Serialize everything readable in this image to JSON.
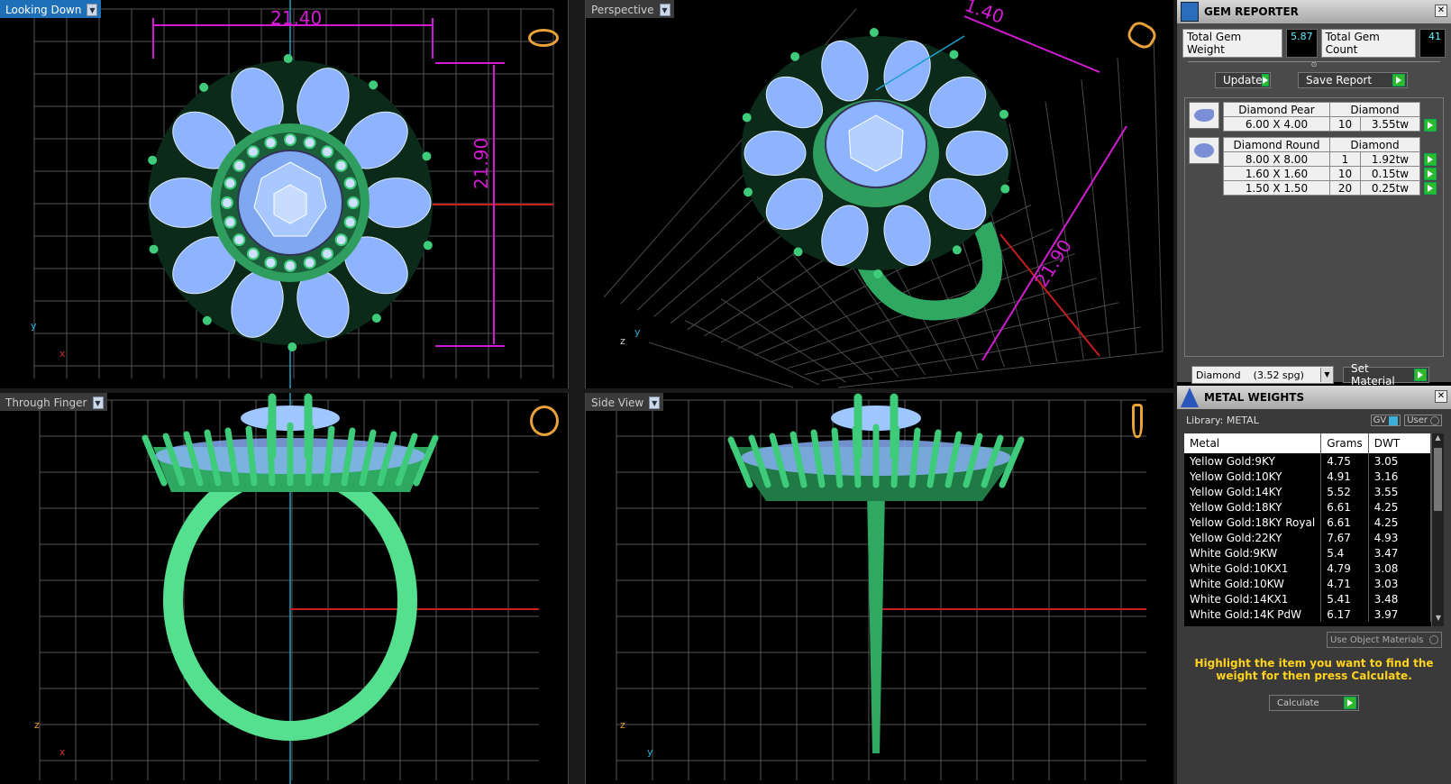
{
  "viewports": {
    "top_left": {
      "label": "Looking Down",
      "dim_width": "21.40",
      "dim_height": "21.90",
      "axis_y": "y",
      "axis_x": "x"
    },
    "top_right": {
      "label": "Perspective",
      "dim_width": "1.40",
      "dim_height": "21.90",
      "axis_z": "z",
      "axis_y": "y"
    },
    "bottom_left": {
      "label": "Through Finger",
      "axis_z": "z",
      "axis_x": "x"
    },
    "bottom_right": {
      "label": "Side View",
      "axis_z": "z",
      "axis_y": "y"
    }
  },
  "gem_reporter": {
    "title": "GEM REPORTER",
    "total_weight_label": "Total Gem Weight",
    "total_weight_value": "5.87",
    "total_count_label": "Total Gem Count",
    "total_count_value": "41",
    "update_label": "Update",
    "save_report_label": "Save Report",
    "groups": [
      {
        "shape": "Diamond Pear",
        "material": "Diamond",
        "rows": [
          {
            "size": "6.00 X 4.00",
            "count": "10",
            "weight": "3.55tw"
          }
        ]
      },
      {
        "shape": "Diamond Round",
        "material": "Diamond",
        "rows": [
          {
            "size": "8.00 X 8.00",
            "count": "1",
            "weight": "1.92tw"
          },
          {
            "size": "1.60 X 1.60",
            "count": "10",
            "weight": "0.15tw"
          },
          {
            "size": "1.50 X 1.50",
            "count": "20",
            "weight": "0.25tw"
          }
        ]
      }
    ],
    "material_select": "Diamond    (3.52 spg)",
    "set_material_label": "Set Material"
  },
  "metal_weights": {
    "title": "METAL WEIGHTS",
    "library_label": "Library: METAL",
    "gv_label": "GV",
    "user_label": "User",
    "columns": [
      "Metal",
      "Grams",
      "DWT"
    ],
    "rows": [
      [
        "Yellow Gold:9KY",
        "4.75",
        "3.05"
      ],
      [
        "Yellow Gold:10KY",
        "4.91",
        "3.16"
      ],
      [
        "Yellow Gold:14KY",
        "5.52",
        "3.55"
      ],
      [
        "Yellow Gold:18KY",
        "6.61",
        "4.25"
      ],
      [
        "Yellow Gold:18KY Royal",
        "6.61",
        "4.25"
      ],
      [
        "Yellow Gold:22KY",
        "7.67",
        "4.93"
      ],
      [
        "White Gold:9KW",
        "5.4",
        "3.47"
      ],
      [
        "White Gold:10KX1",
        "4.79",
        "3.08"
      ],
      [
        "White Gold:10KW",
        "4.71",
        "3.03"
      ],
      [
        "White Gold:14KX1",
        "5.41",
        "3.48"
      ],
      [
        "White Gold:14K PdW",
        "6.17",
        "3.97"
      ]
    ],
    "use_object_materials_label": "Use Object Materials",
    "hint": "Highlight the item you want to find the weight for then press Calculate.",
    "calculate_label": "Calculate"
  },
  "colors": {
    "viewport_label_active": "#1d6fb8",
    "metal_green": "#3ecb7a",
    "gem_blue": "#9fc6ff",
    "dimension_magenta": "#d21cd2",
    "hint_yellow": "#ffd21e",
    "go_green": "#2dbb2d"
  }
}
